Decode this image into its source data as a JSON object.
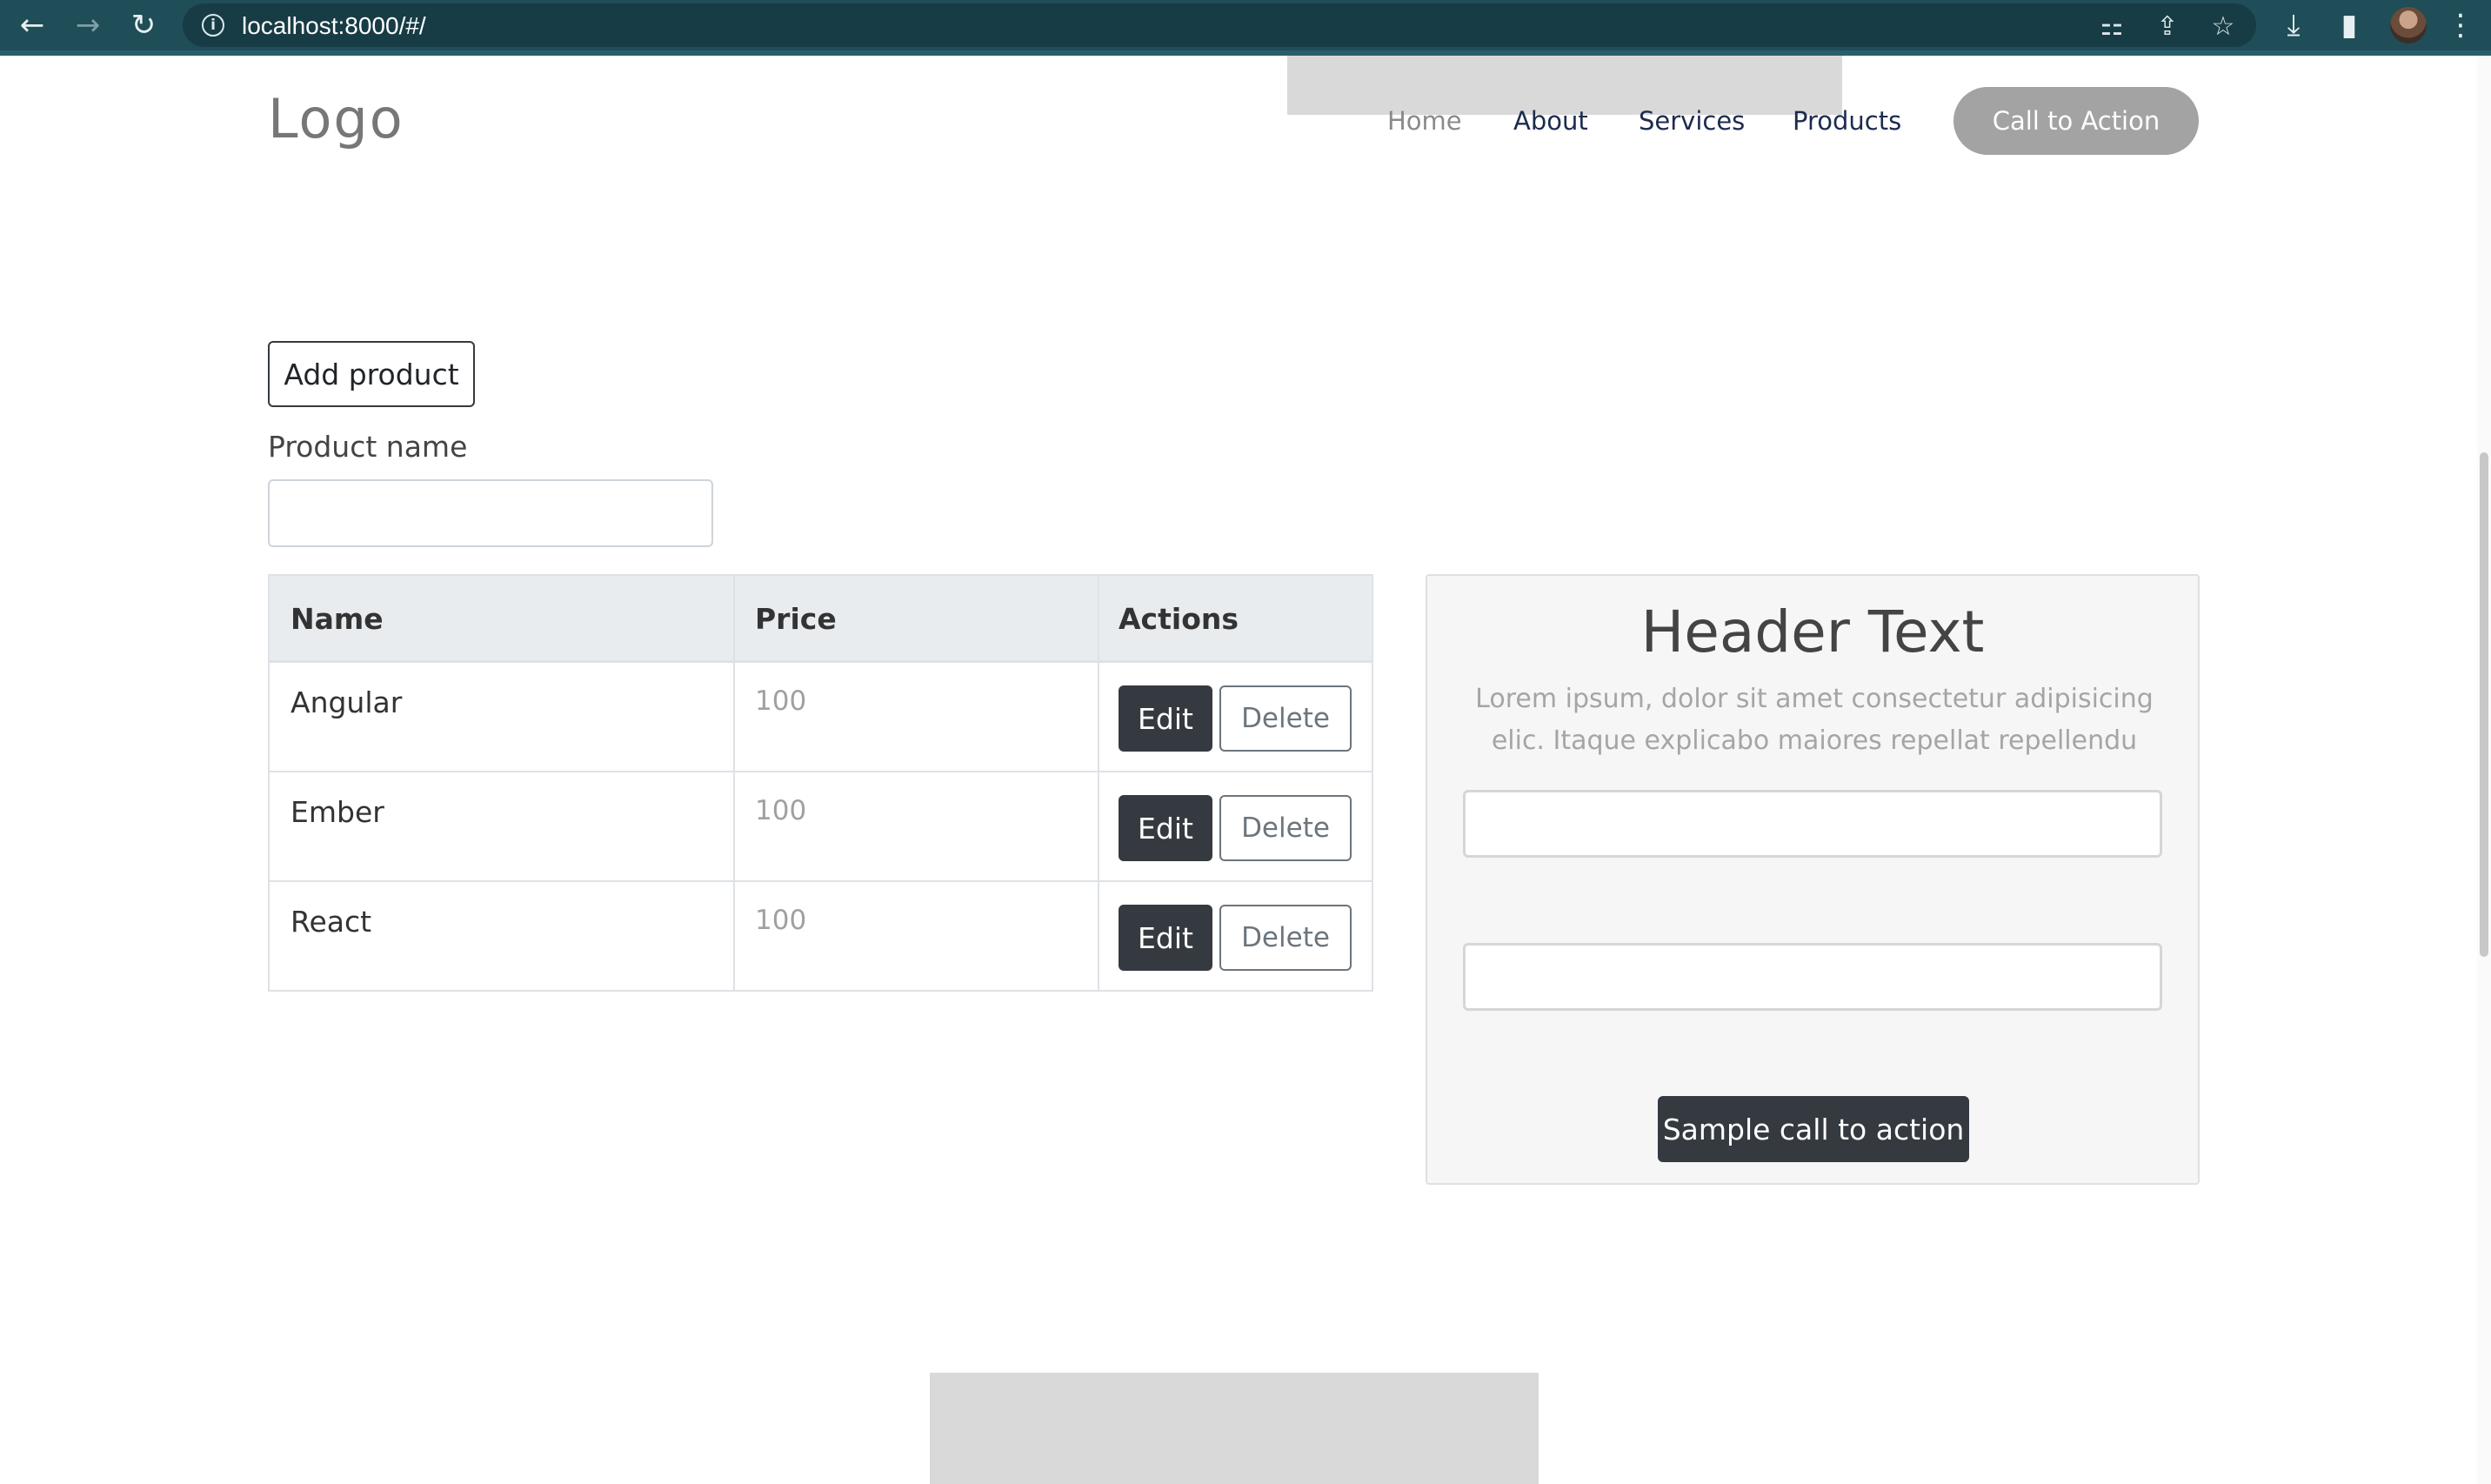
{
  "browser": {
    "url": "localhost:8000/#/",
    "icons": {
      "back": "←",
      "forward": "→",
      "reload": "↻",
      "info": "i",
      "translate": "⚏",
      "share": "⇪",
      "star": "☆",
      "download": "⤓",
      "sidepanel": "▮",
      "menu": "⋮"
    }
  },
  "header": {
    "logo": "Logo",
    "nav": [
      "Home",
      "About",
      "Services",
      "Products"
    ],
    "cta": "Call to Action"
  },
  "form": {
    "add_button": "Add product",
    "product_label": "Product name",
    "product_value": ""
  },
  "table": {
    "columns": [
      "Name",
      "Price",
      "Actions"
    ],
    "rows": [
      {
        "name": "Angular",
        "price": "100",
        "edit": "Edit",
        "delete": "Delete"
      },
      {
        "name": "Ember",
        "price": "100",
        "edit": "Edit",
        "delete": "Delete"
      },
      {
        "name": "React",
        "price": "100",
        "edit": "Edit",
        "delete": "Delete"
      }
    ]
  },
  "card": {
    "title": "Header Text",
    "text": "Lorem ipsum, dolor sit amet consectetur adipisicing elic. Itaque explicabo maiores repellat repellendu",
    "button": "Sample call to action"
  },
  "colors": {
    "chrome": "#1f4d58",
    "dark_button": "#343a40",
    "cta_gray": "#a3a3a3"
  }
}
